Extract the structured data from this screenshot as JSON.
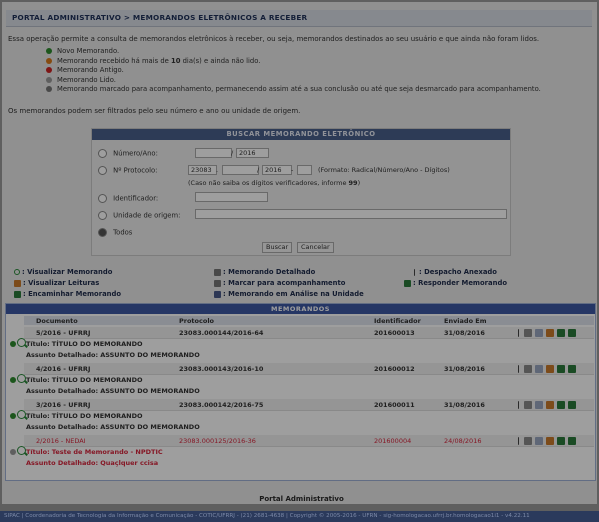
{
  "page": {
    "title": "Portal Administrativo > Memorandos Eletrônicos A Receber",
    "intro": "Essa operação permite a consulta de memorandos eletrônicos à receber, ou seja, memorandos destinados ao seu usuário e que ainda não foram lidos.",
    "legend": [
      {
        "color": "#2e8b2e",
        "pre": "Novo Memorando.",
        "bold": "",
        "post": ""
      },
      {
        "color": "#d87a1a",
        "pre": "Memorando recebido há mais de ",
        "bold": "10",
        "post": " dia(s) e ainda não lido."
      },
      {
        "color": "#cc2222",
        "pre": "Memorando Antigo.",
        "bold": "",
        "post": ""
      },
      {
        "color": "#999999",
        "pre": "Memorando Lido.",
        "bold": "",
        "post": ""
      },
      {
        "color": "#777777",
        "pre": "Memorando marcado para acompanhamento, permanecendo assim até a sua conclusão ou até que seja desmarcado para acompanhamento.",
        "bold": "",
        "post": ""
      }
    ],
    "filter_note": "Os memorandos podem ser filtrados pelo seu número e ano ou unidade de origem."
  },
  "search": {
    "header": "Buscar Memorando Eletrônico",
    "numero_label": "Número/Ano:",
    "numero_year": "2016",
    "protocolo_label": "Nº Protocolo:",
    "prot_radical": "23083",
    "prot_year": "2016",
    "prot_format": "(Formato: Radical/Número/Ano - Dígitos)",
    "prot_hint_pre": "(Caso não saiba os dígitos verificadores, informe ",
    "prot_hint_bold": "99",
    "prot_hint_post": ")",
    "identificador_label": "Identificador:",
    "unidade_label": "Unidade de origem:",
    "todos_label": "Todos",
    "buscar_label": "Buscar",
    "cancelar_label": "Cancelar"
  },
  "actions": [
    {
      "label": "Visualizar Memorando",
      "icon": "magnifier-icon",
      "color": "#2a8a3a"
    },
    {
      "label": "Memorando Detalhado",
      "icon": "document-detail-icon",
      "color": "#666666"
    },
    {
      "label": "Despacho Anexado",
      "icon": "attachment-icon",
      "color": "#444444"
    },
    {
      "label": "Visualizar Leituras",
      "icon": "readings-icon",
      "color": "#c87a2a"
    },
    {
      "label": "Marcar para acompanhamento",
      "icon": "flag-icon",
      "color": "#777777"
    },
    {
      "label": "Responder Memorando",
      "icon": "reply-icon",
      "color": "#2a7a3a"
    },
    {
      "label": "Encaminhar Memorando",
      "icon": "forward-icon",
      "color": "#2a7a3a"
    },
    {
      "label": "Memorando em Análise na Unidade",
      "icon": "analysis-icon",
      "color": "#4a5a8a"
    }
  ],
  "list": {
    "header": "Memorandos",
    "columns": [
      "Documento",
      "Protocolo",
      "Identificador",
      "Enviado Em"
    ],
    "titulo_label": "Título:",
    "assunto_label": "Assunto Detalhado:",
    "records": [
      {
        "documento": "5/2016 - UFRRJ",
        "protocolo": "23083.000144/2016-64",
        "identificador": "201600013",
        "enviado": "31/08/2016",
        "titulo": "TÍTULO DO MEMORANDO",
        "assunto": "ASSUNTO DO MEMORANDO",
        "status_color": "#2e8b2e"
      },
      {
        "documento": "4/2016 - UFRRJ",
        "protocolo": "23083.000143/2016-10",
        "identificador": "201600012",
        "enviado": "31/08/2016",
        "titulo": "TÍTULO DO MEMORANDO",
        "assunto": "ASSUNTO DO MEMORANDO",
        "status_color": "#2e8b2e"
      },
      {
        "documento": "3/2016 - UFRRJ",
        "protocolo": "23083.000142/2016-75",
        "identificador": "201600011",
        "enviado": "31/08/2016",
        "titulo": "TÍTULO DO MEMORANDO",
        "assunto": "ASSUNTO DO MEMORANDO",
        "status_color": "#2e8b2e"
      },
      {
        "documento": "2/2016 - NEDAI",
        "protocolo": "23083.000125/2016-36",
        "identificador": "201600004",
        "enviado": "24/08/2016",
        "titulo": "Teste de Memorando - NPDTIC",
        "assunto": "Quaçlquer ccisa",
        "status_color": "#999999"
      }
    ]
  },
  "footer": {
    "portal": "Portal Administrativo",
    "status": "SIPAC | Coordenadoria de Tecnologia da Informação e Comunicação - COTIC/UFRRJ - (21) 2681-4638 | Copyright © 2005-2016 - UFRN - sig-homologacao.ufrrj.br.homologacao1i1 - v4.22.11"
  }
}
